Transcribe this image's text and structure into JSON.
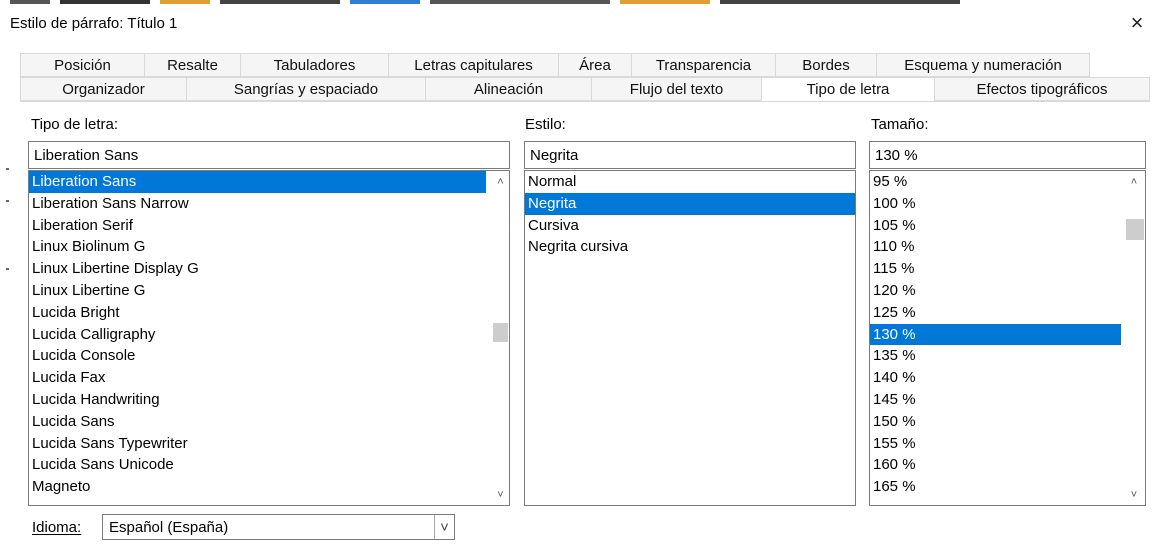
{
  "window": {
    "title": "Estilo de párrafo: Título 1",
    "close_glyph": "×"
  },
  "tabs_row1": [
    "Posición",
    "Resalte",
    "Tabuladores",
    "Letras capitulares",
    "Área",
    "Transparencia",
    "Bordes",
    "Esquema y numeración"
  ],
  "tabs_row2": [
    "Organizador",
    "Sangrías y espaciado",
    "Alineación",
    "Flujo del texto",
    "Tipo de letra",
    "Efectos tipográficos"
  ],
  "active_tab": "Tipo de letra",
  "font": {
    "label": "Tipo de letra:",
    "value": "Liberation Sans",
    "items": [
      "Liberation Sans",
      "Liberation Sans Narrow",
      "Liberation Serif",
      "Linux Biolinum G",
      "Linux Libertine Display G",
      "Linux Libertine G",
      "Lucida Bright",
      "Lucida Calligraphy",
      "Lucida Console",
      "Lucida Fax",
      "Lucida Handwriting",
      "Lucida Sans",
      "Lucida Sans Typewriter",
      "Lucida Sans Unicode",
      "Magneto"
    ],
    "selected": "Liberation Sans"
  },
  "style": {
    "label": "Estilo:",
    "value": "Negrita",
    "items": [
      "Normal",
      "Negrita",
      "Cursiva",
      "Negrita cursiva"
    ],
    "selected": "Negrita"
  },
  "size": {
    "label": "Tamaño:",
    "value": "130 %",
    "items": [
      "95 %",
      "100 %",
      "105 %",
      "110 %",
      "115 %",
      "120 %",
      "125 %",
      "130 %",
      "135 %",
      "140 %",
      "145 %",
      "150 %",
      "155 %",
      "160 %",
      "165 %"
    ],
    "selected": "130 %"
  },
  "language": {
    "label": "Idioma:",
    "value": "Español (España)"
  },
  "icons": {
    "close": "close-icon",
    "scroll_up": "chevron-up-icon",
    "scroll_down": "chevron-down-icon",
    "dropdown": "chevron-down-icon"
  },
  "colors": {
    "selection": "#0078d7",
    "border": "#7a7a7a",
    "tab_bg": "#f5f5f5"
  }
}
